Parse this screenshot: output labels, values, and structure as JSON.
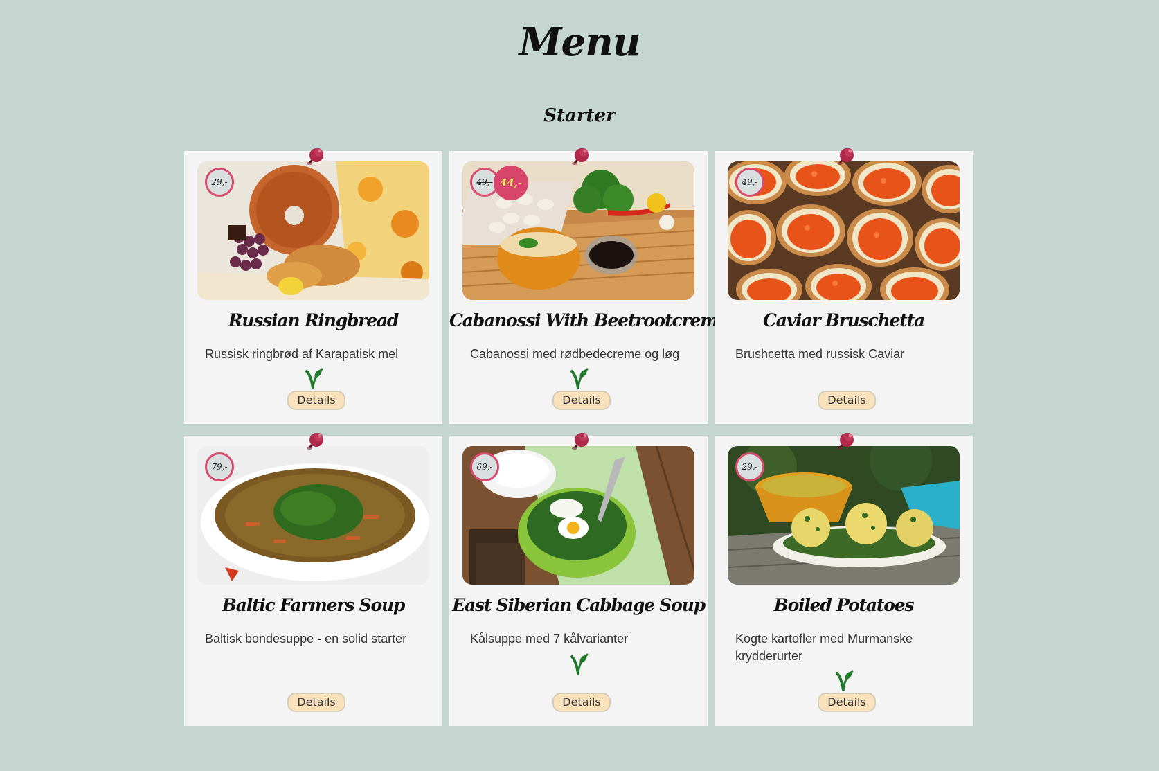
{
  "page": {
    "title": "Menu",
    "section": "Starter"
  },
  "cards": [
    {
      "name": "Russian Ringbread",
      "description": "Russisk ringbrød af Karapatisk mel",
      "price": "29,-",
      "vegetarian": true,
      "details_label": "Details"
    },
    {
      "name": "Cabanossi With Beetrootcreme",
      "description": "Cabanossi med rødbedecreme og løg",
      "price_old": "49,-",
      "price": "44,-",
      "vegetarian": true,
      "details_label": "Details"
    },
    {
      "name": "Caviar Bruschetta",
      "description": "Brushcetta med russisk Caviar",
      "price": "49,-",
      "vegetarian": false,
      "details_label": "Details"
    },
    {
      "name": "Baltic Farmers Soup",
      "description": "Baltisk bondesuppe - en solid starter",
      "price": "79,-",
      "vegetarian": false,
      "details_label": "Details"
    },
    {
      "name": "East Siberian Cabbage Soup",
      "description": "Kålsuppe med 7 kålvarianter",
      "price": "69,-",
      "vegetarian": true,
      "details_label": "Details"
    },
    {
      "name": "Boiled Potatoes",
      "description": "Kogte kartofler med Murmanske krydderurter",
      "price": "29,-",
      "vegetarian": true,
      "details_label": "Details"
    }
  ],
  "colors": {
    "background": "#c5d6d0",
    "card": "#f4f4f4",
    "price_ring": "#d84a6e",
    "sale_badge": "#d8456a",
    "sale_text": "#e4f15a",
    "button": "#f9e2bb",
    "veg_icon": "#1f7a2b",
    "pin": "#b0294a"
  },
  "icons": {
    "pin": "push-pin-icon",
    "vegetarian": "vegetarian-leaf-icon"
  }
}
